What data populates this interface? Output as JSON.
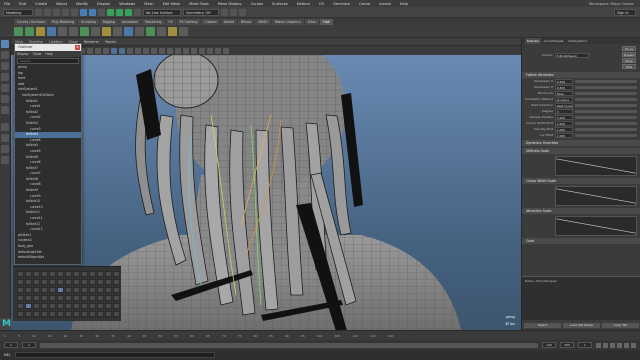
{
  "menubar": {
    "items": [
      "File",
      "Edit",
      "Create",
      "Select",
      "Modify",
      "Display",
      "Windows",
      "Mesh",
      "Edit Mesh",
      "Mesh Tools",
      "Mesh Display",
      "Curves",
      "Surfaces",
      "Deform",
      "UV",
      "Generate",
      "Cache",
      "Arnold",
      "Help"
    ],
    "workspace": "Workspace: Maya Classic"
  },
  "statusline": {
    "mode": "Modeling",
    "no_live_surface": "No Live Surface",
    "symmetry": "Symmetry: Off",
    "sign_in": "Sign In"
  },
  "shelf_tabs": [
    "Curves / Surfaces",
    "Poly Modeling",
    "Sculpting",
    "Rigging",
    "Animation",
    "Rendering",
    "FX",
    "FX Caching",
    "Custom",
    "Arnold",
    "Bifrost",
    "MASH",
    "Motion Graphics",
    "XGen",
    "Hair"
  ],
  "shelf_active_tab": "Hair",
  "panel": {
    "menus": [
      "View",
      "Shading",
      "Lighting",
      "Show",
      "Renderer",
      "Panels"
    ],
    "camera_label": "persp",
    "fps_label": "30 fps"
  },
  "outliner": {
    "title": "Outliner",
    "menus": [
      "Display",
      "Show",
      "Help"
    ],
    "search_placeholder": "Search...",
    "items": [
      {
        "label": "persp",
        "depth": 0,
        "selected": false
      },
      {
        "label": "top",
        "depth": 0,
        "selected": false
      },
      {
        "label": "front",
        "depth": 0,
        "selected": false
      },
      {
        "label": "side",
        "depth": 0,
        "selected": false
      },
      {
        "label": "hairSystem1",
        "depth": 0,
        "selected": false
      },
      {
        "label": "hairSystem1Follicles",
        "depth": 1,
        "selected": false
      },
      {
        "label": "follicle1",
        "depth": 2,
        "selected": false
      },
      {
        "label": "curve1",
        "depth": 3,
        "selected": false
      },
      {
        "label": "follicle2",
        "depth": 2,
        "selected": false
      },
      {
        "label": "curve2",
        "depth": 3,
        "selected": false
      },
      {
        "label": "follicle3",
        "depth": 2,
        "selected": false
      },
      {
        "label": "curve3",
        "depth": 3,
        "selected": false
      },
      {
        "label": "follicle4",
        "depth": 2,
        "selected": true
      },
      {
        "label": "curve4",
        "depth": 3,
        "selected": false
      },
      {
        "label": "follicle5",
        "depth": 2,
        "selected": false
      },
      {
        "label": "curve5",
        "depth": 3,
        "selected": false
      },
      {
        "label": "follicle6",
        "depth": 2,
        "selected": false
      },
      {
        "label": "curve6",
        "depth": 3,
        "selected": false
      },
      {
        "label": "follicle7",
        "depth": 2,
        "selected": false
      },
      {
        "label": "curve7",
        "depth": 3,
        "selected": false
      },
      {
        "label": "follicle8",
        "depth": 2,
        "selected": false
      },
      {
        "label": "curve8",
        "depth": 3,
        "selected": false
      },
      {
        "label": "follicle9",
        "depth": 2,
        "selected": false
      },
      {
        "label": "curve9",
        "depth": 3,
        "selected": false
      },
      {
        "label": "follicle10",
        "depth": 2,
        "selected": false
      },
      {
        "label": "curve10",
        "depth": 3,
        "selected": false
      },
      {
        "label": "follicle11",
        "depth": 2,
        "selected": false
      },
      {
        "label": "curve11",
        "depth": 3,
        "selected": false
      },
      {
        "label": "follicle12",
        "depth": 2,
        "selected": false
      },
      {
        "label": "curve12",
        "depth": 3,
        "selected": false
      },
      {
        "label": "pfxHair1",
        "depth": 0,
        "selected": false
      },
      {
        "label": "nucleus1",
        "depth": 0,
        "selected": false
      },
      {
        "label": "body_geo",
        "depth": 0,
        "selected": false
      },
      {
        "label": "defaultLightSet",
        "depth": 0,
        "selected": false
      },
      {
        "label": "defaultObjectSet",
        "depth": 0,
        "selected": false
      }
    ]
  },
  "attribute_editor": {
    "tabs": [
      "follicle4",
      "curveShape4",
      "hairSystem1"
    ],
    "node_label": "follicle:",
    "node_name": "follicleShape4",
    "buttons": {
      "focus": "Focus",
      "presets": "Presets",
      "show": "Show",
      "hide": "Hide"
    },
    "sections": {
      "follicle_attributes": "Follicle Attributes",
      "dynamics_overrides": "Dynamics Overrides",
      "stiffness_scale": "Stiffness Scale",
      "clump_width_scale": "Clump Width Scale",
      "attraction_scale": "Attraction Scale",
      "color": "Color"
    },
    "fields": [
      {
        "label": "Parameter U",
        "value": "0.500"
      },
      {
        "label": "Parameter V",
        "value": "0.500"
      },
      {
        "label": "Point Lock",
        "value": "Base"
      },
      {
        "label": "Simulation Method",
        "value": "Dynamic"
      },
      {
        "label": "Start Direction",
        "value": "Rest Curve"
      },
      {
        "label": "Degree",
        "value": "3"
      },
      {
        "label": "Sample Density",
        "value": "1.000"
      },
      {
        "label": "Clump Width Mult",
        "value": "1.000"
      },
      {
        "label": "Density Mult",
        "value": "1.000"
      },
      {
        "label": "Curl Mult",
        "value": "1.000"
      }
    ],
    "notes_label": "Notes: follicleShape4",
    "bottom_buttons": [
      "Select",
      "Load Attributes",
      "Copy Tab"
    ]
  },
  "timeline": {
    "ticks": [
      "1",
      "5",
      "10",
      "15",
      "20",
      "25",
      "30",
      "35",
      "40",
      "45",
      "50",
      "55",
      "60",
      "65",
      "70",
      "75",
      "80",
      "85",
      "90",
      "95",
      "100",
      "105",
      "110",
      "115",
      "120"
    ],
    "start": "1",
    "end": "120",
    "range_end": "200",
    "current": "1"
  },
  "command_line": {
    "language": "MEL"
  },
  "colors": {
    "viewport_top": "#6a8ab3",
    "viewport_bottom": "#3d566f",
    "selection": "#4a6f99",
    "maya_logo": "#38c2c9",
    "close_button": "#c94c4c"
  }
}
